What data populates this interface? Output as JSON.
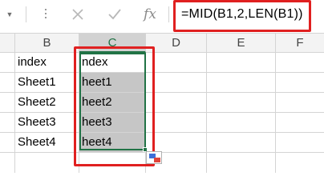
{
  "formula_bar": {
    "formula": "=MID(B1,2,LEN(B1))",
    "fx_label": "fx"
  },
  "columns": [
    {
      "label": "B",
      "selected": false
    },
    {
      "label": "C",
      "selected": true
    },
    {
      "label": "D",
      "selected": false
    },
    {
      "label": "E",
      "selected": false
    },
    {
      "label": "F",
      "selected": false
    }
  ],
  "rows": [
    {
      "B": "index",
      "C": "ndex"
    },
    {
      "B": "Sheet1",
      "C": "heet1"
    },
    {
      "B": "Sheet2",
      "C": "heet2"
    },
    {
      "B": "Sheet3",
      "C": "heet3"
    },
    {
      "B": "Sheet4",
      "C": "heet4"
    }
  ],
  "colors": {
    "selection": "#217346",
    "highlight": "#e02020",
    "selected_fill": "#c6c6c6"
  }
}
